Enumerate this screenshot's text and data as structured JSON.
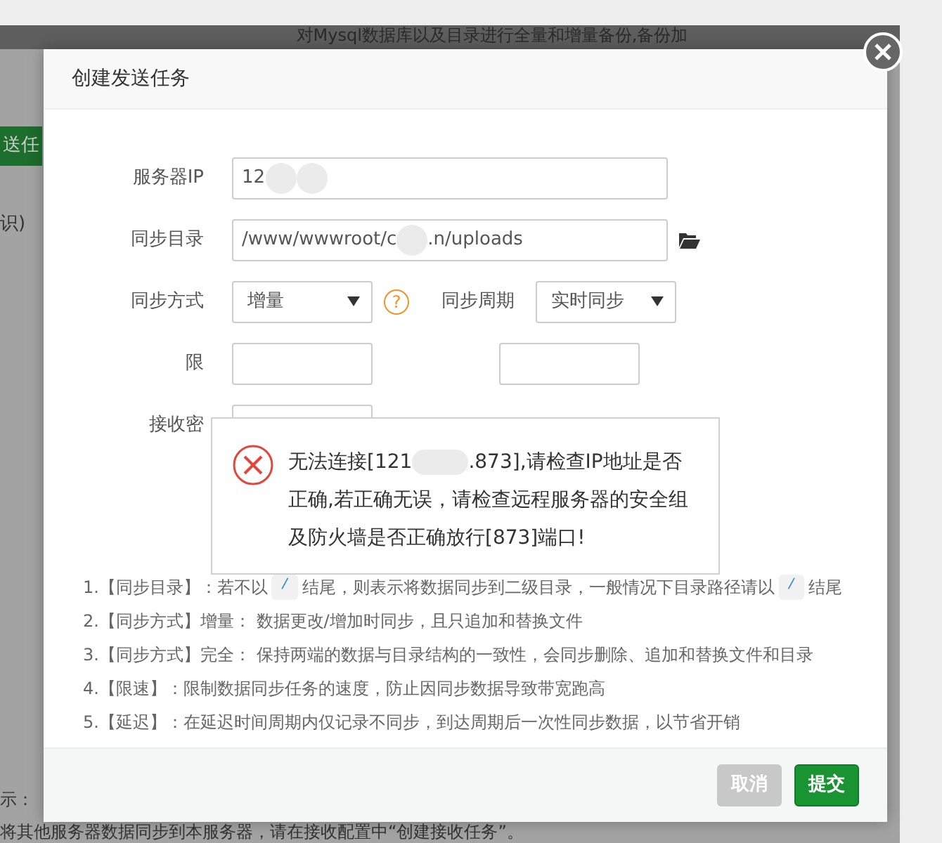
{
  "background": {
    "banner": "对Mysql数据库以及目录进行全量和增量备份,备份加",
    "button": "送任",
    "text": "识)",
    "tip_label": "示：",
    "tip": "将其他服务器数据同步到本服务器，请在接收配置中“创建接收任务”。"
  },
  "dialog": {
    "title": "创建发送任务",
    "rows": [
      {
        "fields": [
          {
            "kind": "text",
            "label": "服务器IP",
            "value": [
              {
                "kind": "text",
                "text": "12"
              },
              {
                "kind": "redacted"
              },
              {
                "kind": "redacted"
              }
            ]
          }
        ]
      },
      {
        "fields": [
          {
            "kind": "path",
            "label": "同步目录",
            "value": [
              {
                "kind": "text",
                "text": "/www/wwwroot/c"
              },
              {
                "kind": "redacted"
              },
              {
                "kind": "text",
                "text": ".n/uploads"
              }
            ]
          }
        ]
      },
      {
        "fields": [
          {
            "kind": "select",
            "label": "同步方式",
            "value": "增量",
            "help": "?"
          },
          {
            "kind": "select",
            "label": "同步周期",
            "value": "实时同步"
          }
        ]
      },
      {
        "fields": [
          {
            "kind": "hidden",
            "label": "限"
          },
          {
            "kind": "hidden"
          }
        ]
      },
      {
        "fields": [
          {
            "kind": "hidden",
            "label": "接收密"
          }
        ]
      }
    ],
    "error": {
      "message": [
        {
          "kind": "text",
          "text": "无法连接[121"
        },
        {
          "kind": "redacted"
        },
        {
          "kind": "text",
          "text": ".873],请检查IP地址是否正确,若正确无误，请检查远程服务器的安全组及防火墙是否正确放行[873]端口!"
        }
      ]
    },
    "notes": [
      {
        "number": "1.",
        "parts": [
          {
            "kind": "text",
            "text": "【同步目录】：若不以"
          },
          {
            "kind": "code",
            "text": "/"
          },
          {
            "kind": "text",
            "text": "结尾，则表示将数据同步到二级目录，一般情况下目录路径请以"
          },
          {
            "kind": "code",
            "text": "/"
          },
          {
            "kind": "text",
            "text": "结尾"
          }
        ]
      },
      {
        "number": "2.",
        "parts": [
          {
            "kind": "text",
            "text": "【同步方式】增量： 数据更改/增加时同步，且只追加和替换文件"
          }
        ]
      },
      {
        "number": "3.",
        "parts": [
          {
            "kind": "text",
            "text": "【同步方式】完全： 保持两端的数据与目录结构的一致性，会同步删除、追加和替换文件和目录"
          }
        ]
      },
      {
        "number": "4.",
        "parts": [
          {
            "kind": "text",
            "text": "【限速】：限制数据同步任务的速度，防止因同步数据导致带宽跑高"
          }
        ]
      },
      {
        "number": "5.",
        "parts": [
          {
            "kind": "text",
            "text": "【延迟】：在延迟时间周期内仅记录不同步，到达周期后一次性同步数据，以节省开销"
          }
        ]
      }
    ],
    "buttons": [
      {
        "kind": "cancel",
        "label": "取消"
      },
      {
        "kind": "submit",
        "label": "提交"
      }
    ]
  }
}
